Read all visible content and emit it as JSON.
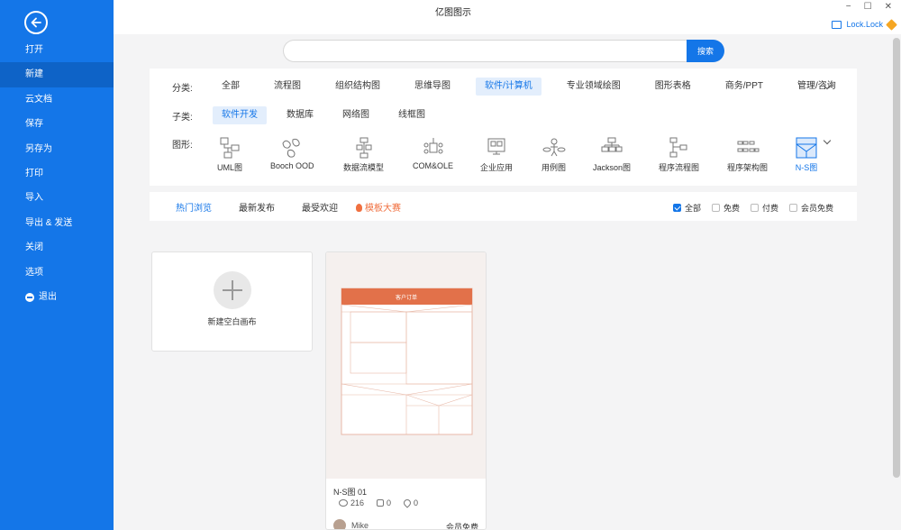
{
  "app": {
    "title": "亿图图示"
  },
  "window": {
    "minimize": "−",
    "maximize": "☐",
    "close": "✕"
  },
  "user": {
    "name": "Lock.Lock"
  },
  "sidebar": {
    "items": [
      {
        "label": "打开"
      },
      {
        "label": "新建"
      },
      {
        "label": "云文档"
      },
      {
        "label": "保存"
      },
      {
        "label": "另存为"
      },
      {
        "label": "打印"
      },
      {
        "label": "导入"
      },
      {
        "label": "导出 & 发送"
      },
      {
        "label": "关闭"
      },
      {
        "label": "选项"
      },
      {
        "label": "退出"
      }
    ],
    "active_index": 1
  },
  "search": {
    "value": "",
    "placeholder": "",
    "button": "搜索"
  },
  "filters": {
    "category_label": "分类:",
    "categories": [
      "全部",
      "流程图",
      "组织结构图",
      "思维导图",
      "软件/计算机",
      "专业领域绘图",
      "图形表格",
      "商务/PPT",
      "管理/咨询"
    ],
    "category_selected": 4,
    "subcategory_label": "子类:",
    "subcategories": [
      "软件开发",
      "数据库",
      "网络图",
      "线框图"
    ],
    "subcategory_selected": 0,
    "shape_label": "图形:",
    "shapes": [
      {
        "label": "UML图",
        "icon": "uml-icon"
      },
      {
        "label": "Booch OOD",
        "icon": "booch-icon"
      },
      {
        "label": "数据流模型",
        "icon": "dataflow-icon"
      },
      {
        "label": "COM&OLE",
        "icon": "com-ole-icon"
      },
      {
        "label": "企业应用",
        "icon": "enterprise-icon"
      },
      {
        "label": "用例图",
        "icon": "usecase-icon"
      },
      {
        "label": "Jackson图",
        "icon": "jackson-icon"
      },
      {
        "label": "程序流程图",
        "icon": "program-flow-icon"
      },
      {
        "label": "程序架构图",
        "icon": "program-arch-icon"
      },
      {
        "label": "N-S图",
        "icon": "ns-icon"
      }
    ],
    "shape_selected": 9
  },
  "tabs": {
    "items": [
      "热门浏览",
      "最新发布",
      "最受欢迎",
      "模板大赛"
    ],
    "selected": 0,
    "checkboxes": [
      {
        "label": "全部",
        "checked": true
      },
      {
        "label": "免费",
        "checked": false
      },
      {
        "label": "付费",
        "checked": false
      },
      {
        "label": "会员免费",
        "checked": false
      }
    ]
  },
  "new_card": {
    "label": "新建空白画布"
  },
  "template": {
    "name": "N-S图 01",
    "views": "216",
    "likes": "0",
    "favorites": "0",
    "author": "Mike",
    "price": "会员免费",
    "thumb_title": "客户订单",
    "accent": "#e2714a"
  },
  "colors": {
    "primary": "#1476e8",
    "sidebar_active": "#0e63c7",
    "hot": "#f07040"
  }
}
